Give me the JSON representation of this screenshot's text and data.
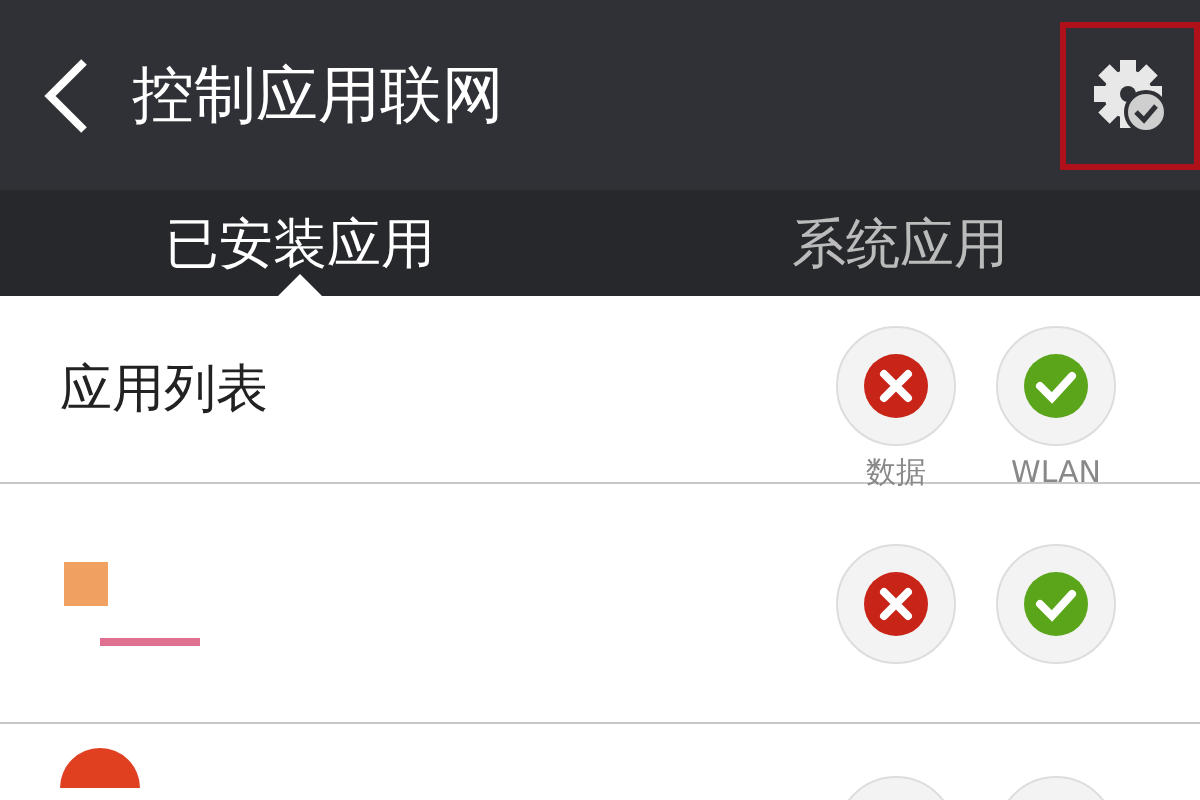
{
  "header": {
    "title": "控制应用联网",
    "settings_highlighted": true
  },
  "tabs": [
    {
      "label": "已安装应用",
      "selected": true
    },
    {
      "label": "系统应用",
      "selected": false
    }
  ],
  "list_header": {
    "title": "应用列表",
    "columns": [
      {
        "label": "数据",
        "allowed": false
      },
      {
        "label": "WLAN",
        "allowed": true
      }
    ]
  },
  "apps": [
    {
      "data_allowed": false,
      "wlan_allowed": true
    }
  ]
}
